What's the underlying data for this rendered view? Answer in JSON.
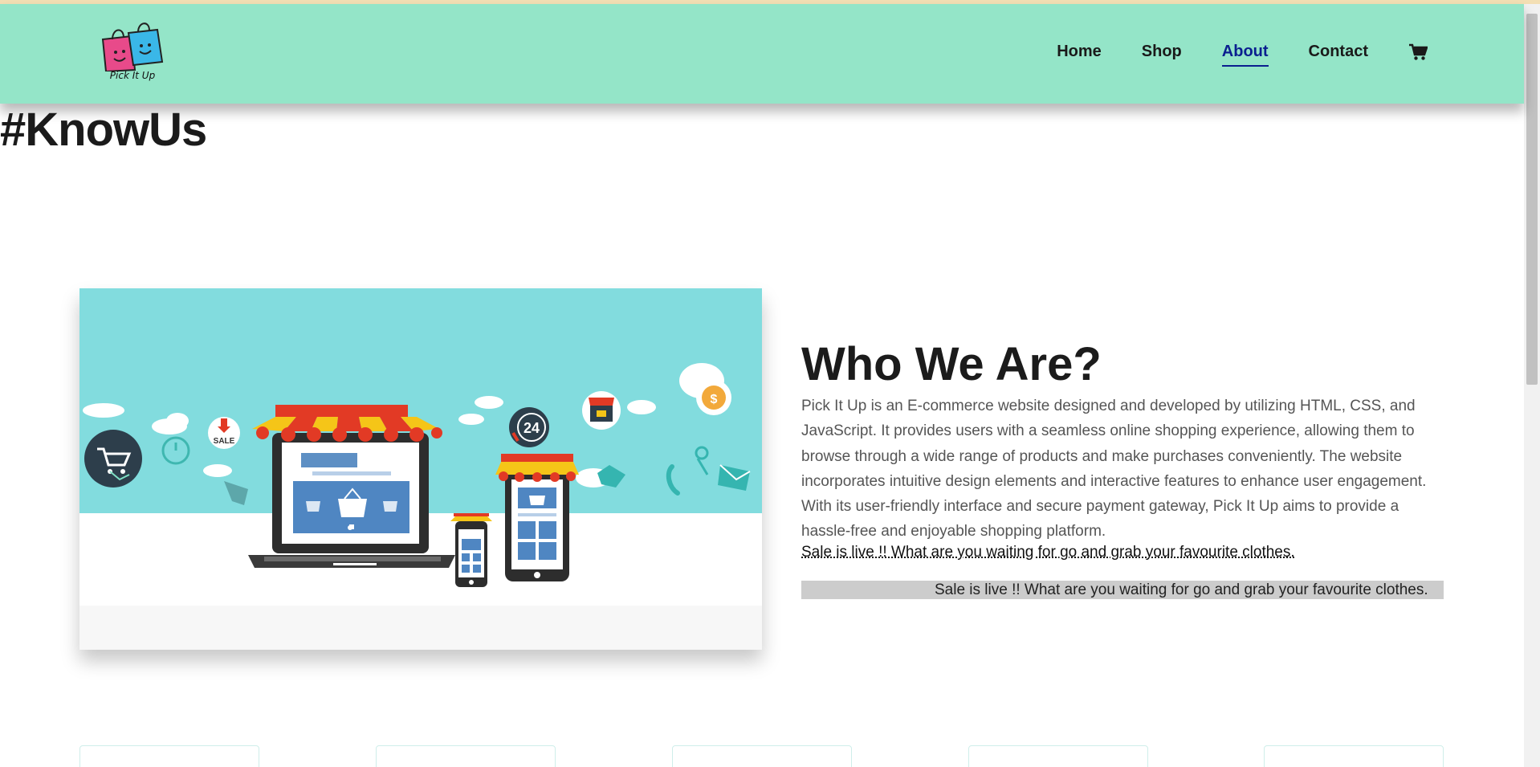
{
  "header": {
    "logo_text": "Pick It Up",
    "nav": [
      {
        "label": "Home",
        "active": false
      },
      {
        "label": "Shop",
        "active": false
      },
      {
        "label": "About",
        "active": true
      },
      {
        "label": "Contact",
        "active": false
      }
    ],
    "cart_icon": "shopping-cart-icon",
    "background": "#94e5c8"
  },
  "page_heading": "#KnowUs",
  "about": {
    "title": "Who We Are?",
    "body": "Pick It Up is an E-commerce website designed and developed by utilizing HTML, CSS, and JavaScript. It provides users with a seamless online shopping experience, allowing them to browse through a wide range of products and make purchases conveniently. The website incorporates intuitive design elements and interactive features to enhance user engagement. With its user-friendly interface and secure payment gateway, Pick It Up aims to provide a hassle-free and enjoyable shopping platform.",
    "sale_link": "Sale is live !! What are you waiting for go and grab your favourite clothes.",
    "marquee": "Sale is live !! What are you waiting for go and grab your favourite clothes."
  },
  "hero_image": {
    "sale_badge": "SALE",
    "clock_badge": "24"
  },
  "colors": {
    "accent_active": "#0a1f8f",
    "hero_sky": "#82dcde",
    "awning_red": "#e23a25",
    "awning_yellow": "#f5c518"
  }
}
